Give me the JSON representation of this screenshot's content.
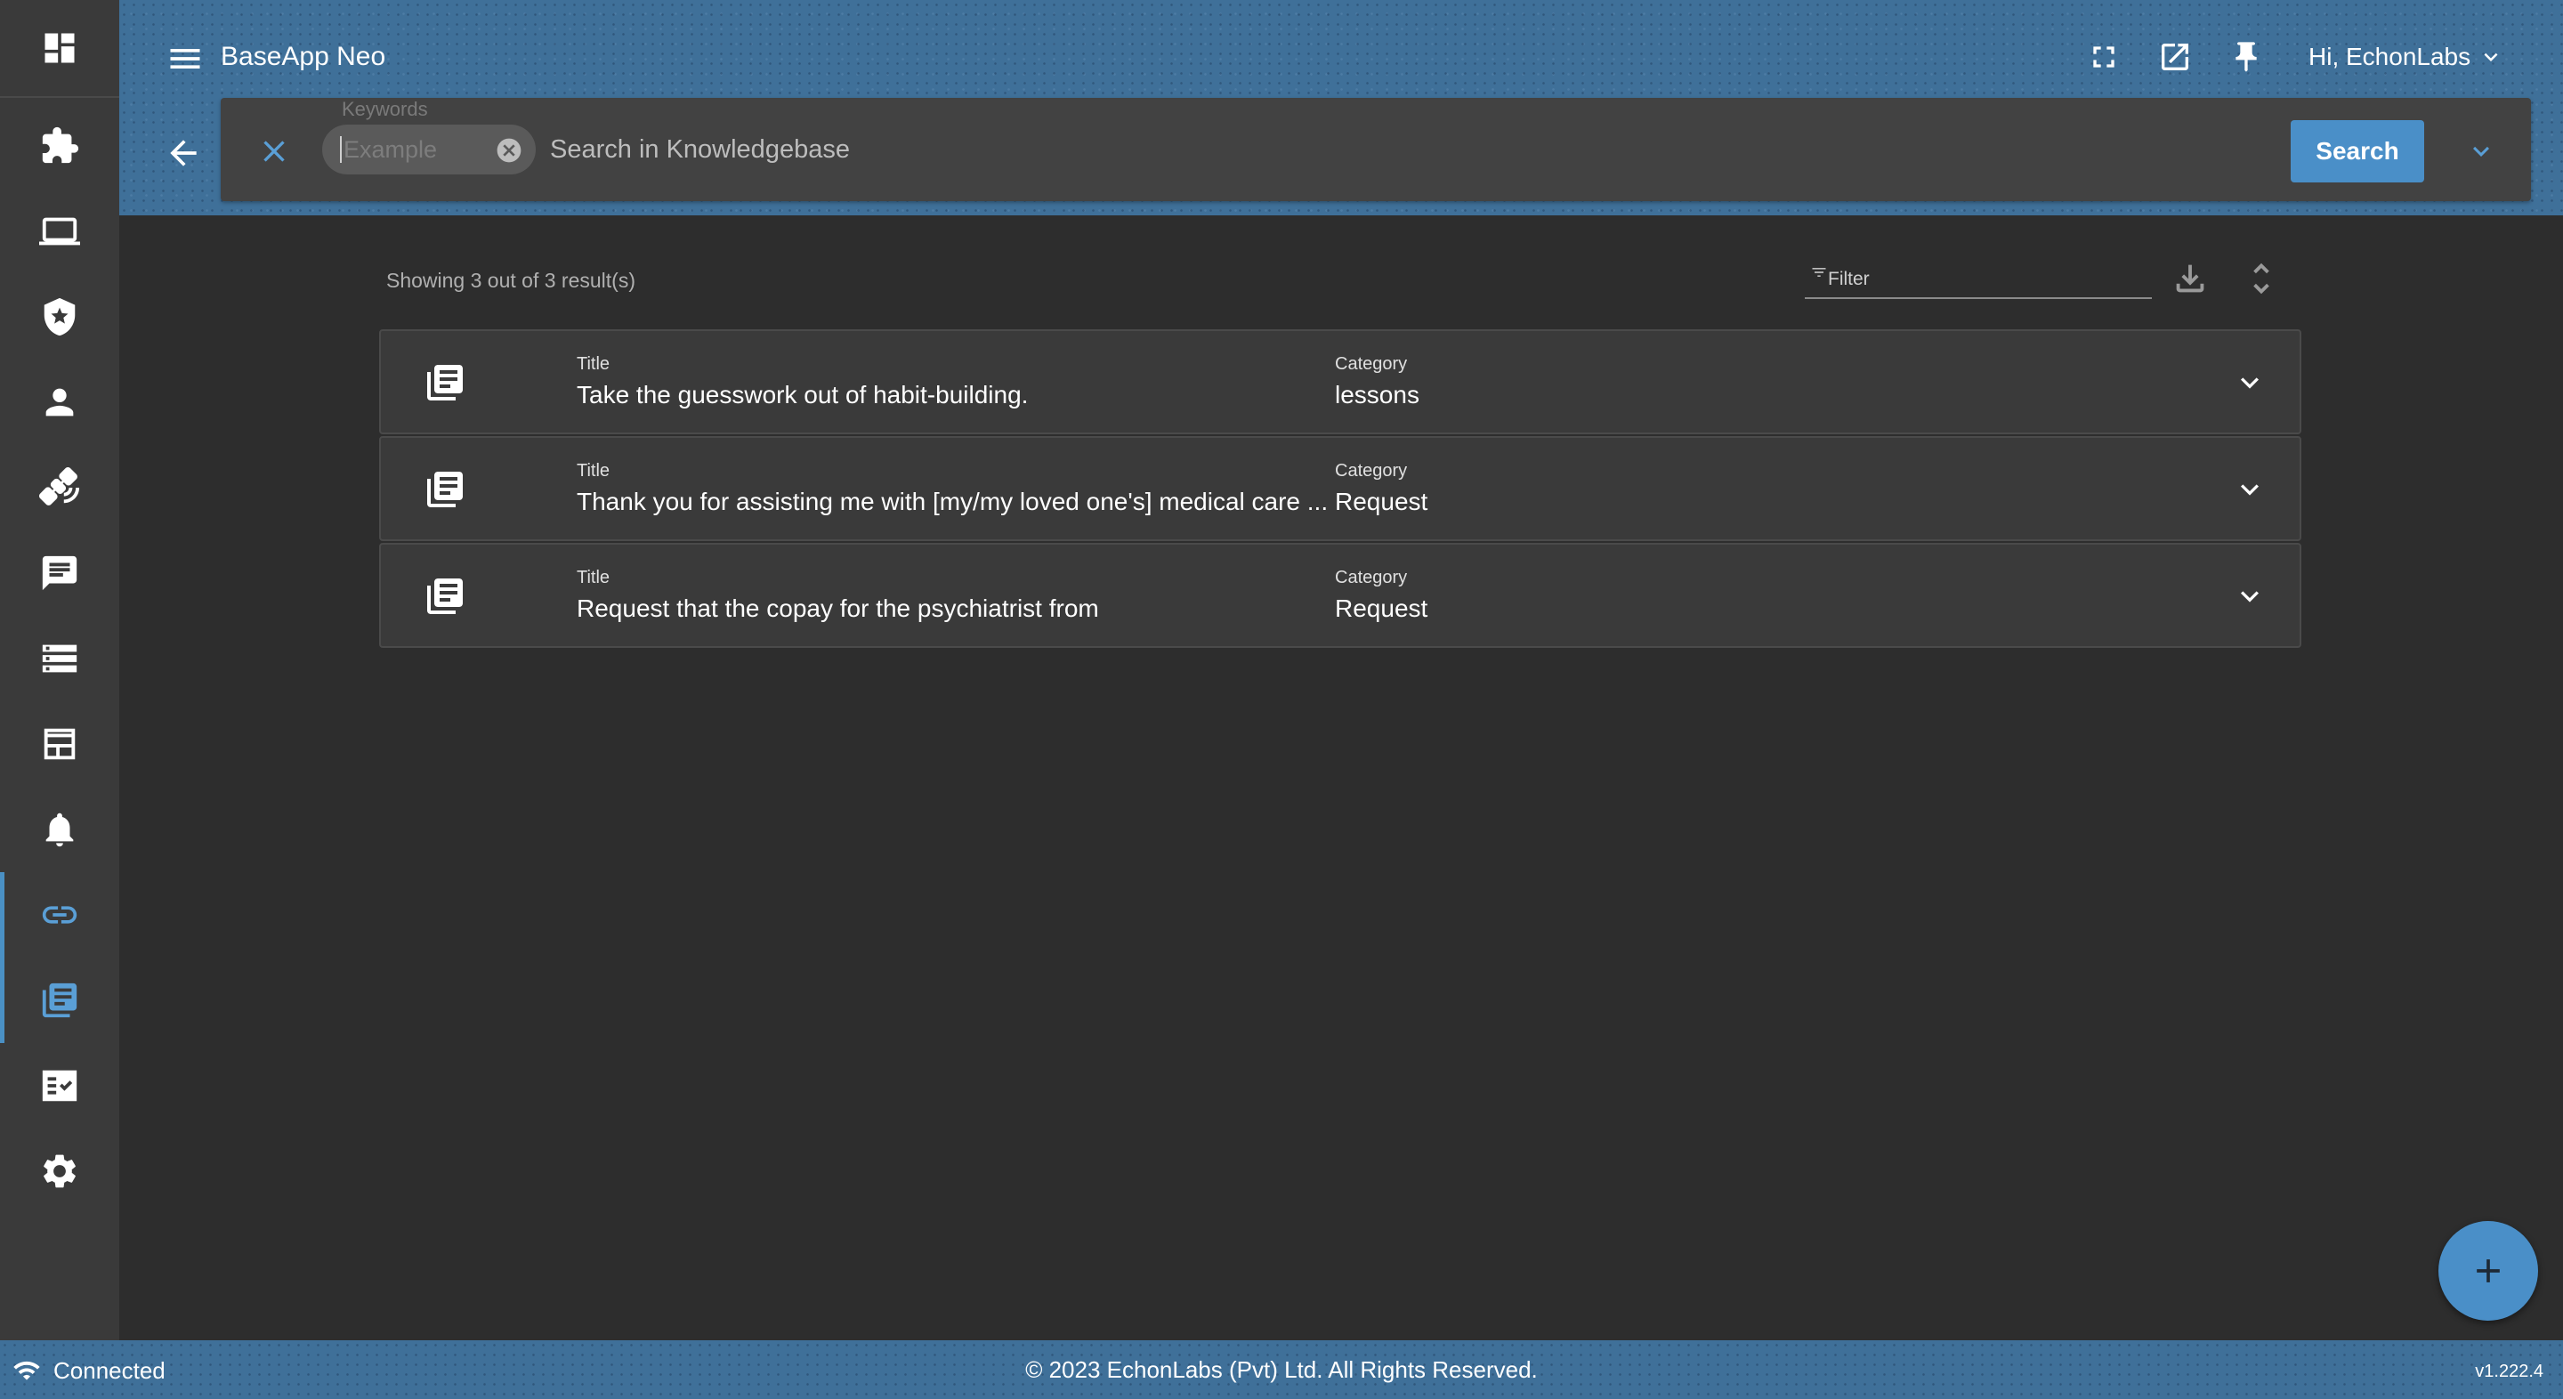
{
  "header": {
    "app_title": "BaseApp Neo",
    "greeting": "Hi, EchonLabs"
  },
  "search": {
    "keywords_label": "Keywords",
    "keyword_placeholder": "Example",
    "hint_text": "Search in Knowledgebase",
    "search_button_label": "Search"
  },
  "results": {
    "count_text": "Showing 3 out of 3 result(s)",
    "filter_label": "Filter",
    "title_label": "Title",
    "category_label": "Category",
    "items": [
      {
        "title": "Take the guesswork out of habit-building.",
        "category": "lessons"
      },
      {
        "title": "Thank you for assisting me with [my/my loved one's] medical care ...",
        "category": "Request"
      },
      {
        "title": "Request that the copay for the psychiatrist from",
        "category": "Request"
      }
    ]
  },
  "footer": {
    "status": "Connected",
    "copyright": "© 2023 EchonLabs (Pvt) Ltd. All Rights Reserved.",
    "version": "v1.222.4"
  },
  "sidebar": {
    "items": [
      "dashboard-icon",
      "puzzle-icon",
      "laptop-icon",
      "shield-icon",
      "person-icon",
      "satellite-icon",
      "chat-icon",
      "storage-icon",
      "table-icon",
      "bell-icon",
      "link-icon",
      "knowledgebase-icon",
      "checklist-icon",
      "gear-icon"
    ],
    "active_item": "knowledgebase-icon"
  },
  "colors": {
    "accent": "#4a8fc8",
    "header_bg": "#3f7099",
    "sidebar_bg": "#3a3a3a",
    "main_bg": "#2d2d2d",
    "row_bg": "#3a3a3a"
  }
}
